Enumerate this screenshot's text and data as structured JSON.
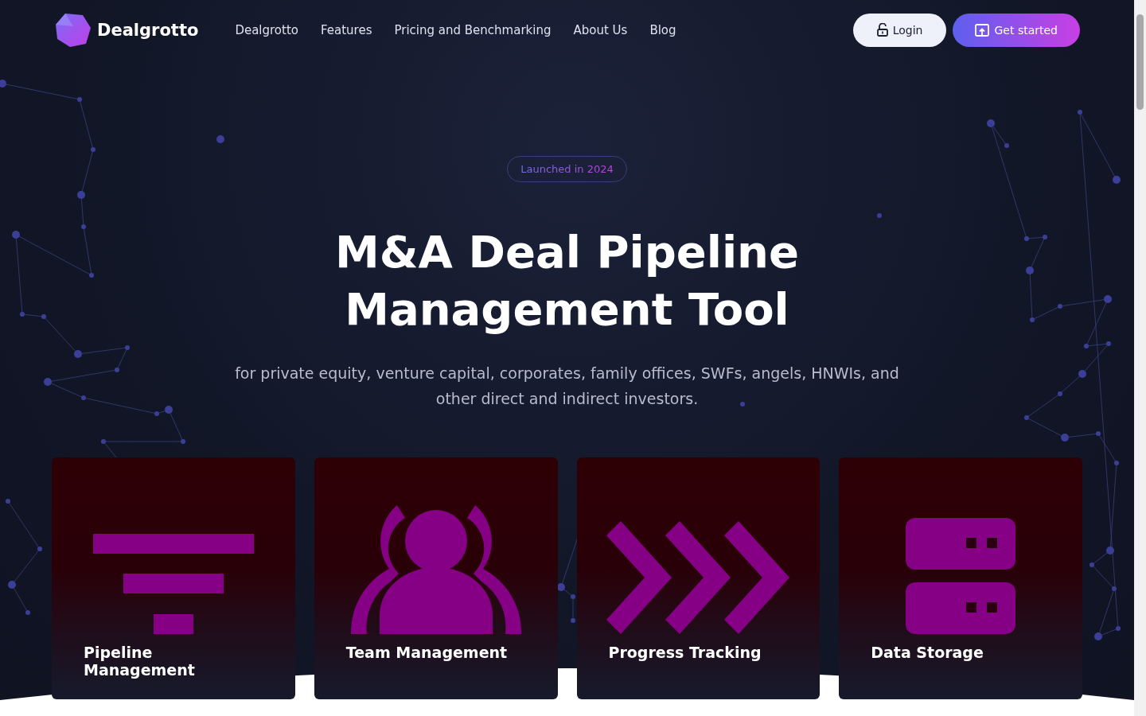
{
  "brand": {
    "name": "Dealgrotto"
  },
  "nav": [
    {
      "label": "Dealgrotto"
    },
    {
      "label": "Features"
    },
    {
      "label": "Pricing and Benchmarking"
    },
    {
      "label": "About Us"
    },
    {
      "label": "Blog"
    }
  ],
  "actions": [
    {
      "kind": "login",
      "label": "Login"
    },
    {
      "kind": "start",
      "label": "Get started"
    }
  ],
  "hero": {
    "badge": "Launched in 2024",
    "title_lines": [
      "M&A Deal Pipeline",
      "Management Tool"
    ],
    "subtitle": "for private equity, venture capital, corporates, family offices, SWFs, angels, HNWIs, and other direct and indirect investors."
  },
  "cards": [
    {
      "kind": "funnel",
      "title": "Pipeline Management"
    },
    {
      "kind": "team",
      "title": "Team Management"
    },
    {
      "kind": "chevrons",
      "title": "Progress Tracking"
    },
    {
      "kind": "storage",
      "title": "Data Storage"
    }
  ]
}
